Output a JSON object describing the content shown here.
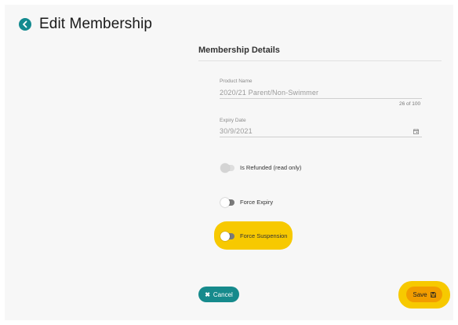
{
  "header": {
    "title": "Edit Membership",
    "back_icon": "back-arrow-circle-icon"
  },
  "section": {
    "title": "Membership Details"
  },
  "fields": {
    "product_name": {
      "label": "Product Name",
      "value": "2020/21 Parent/Non-Swimmer",
      "counter": "26 of 100"
    },
    "expiry_date": {
      "label": "Expiry Date",
      "value": "30/9/2021",
      "icon": "calendar-icon"
    }
  },
  "toggles": {
    "is_refunded": {
      "label": "Is Refunded (read only)",
      "checked": false,
      "disabled": true
    },
    "force_expiry": {
      "label": "Force Expiry",
      "checked": false
    },
    "force_suspension": {
      "label": "Force Suspension",
      "checked": false
    }
  },
  "actions": {
    "cancel_label": "Cancel",
    "save_label": "Save"
  },
  "colors": {
    "accent": "#168a8c",
    "save": "#f29d00",
    "highlight": "#f7c900"
  }
}
